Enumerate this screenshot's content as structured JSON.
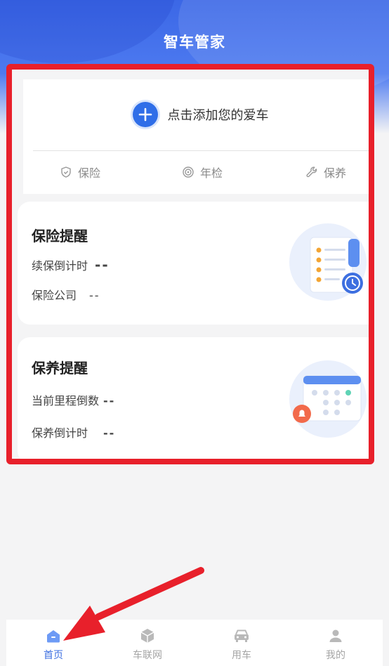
{
  "app": {
    "title": "智车管家"
  },
  "add_car": {
    "label": "点击添加您的爱车"
  },
  "quick_links": [
    {
      "label": "保险",
      "icon": "shield-icon"
    },
    {
      "label": "年检",
      "icon": "target-icon"
    },
    {
      "label": "保养",
      "icon": "wrench-icon"
    }
  ],
  "insurance": {
    "title": "保险提醒",
    "renewal_label": "续保倒计时",
    "renewal_value": "--",
    "company_label": "保险公司",
    "company_value": "--"
  },
  "maintenance": {
    "title": "保养提醒",
    "mileage_label": "当前里程倒数",
    "mileage_value": "--",
    "countdown_label": "保养倒计时",
    "countdown_value": "--"
  },
  "tabs": [
    {
      "label": "首页",
      "icon": "home-icon",
      "active": true
    },
    {
      "label": "车联网",
      "icon": "box-icon",
      "active": false
    },
    {
      "label": "用车",
      "icon": "car-icon",
      "active": false
    },
    {
      "label": "我的",
      "icon": "user-icon",
      "active": false
    }
  ],
  "colors": {
    "accent": "#3d6fe0",
    "highlight": "#e8202b",
    "header": "#3b67e6"
  }
}
